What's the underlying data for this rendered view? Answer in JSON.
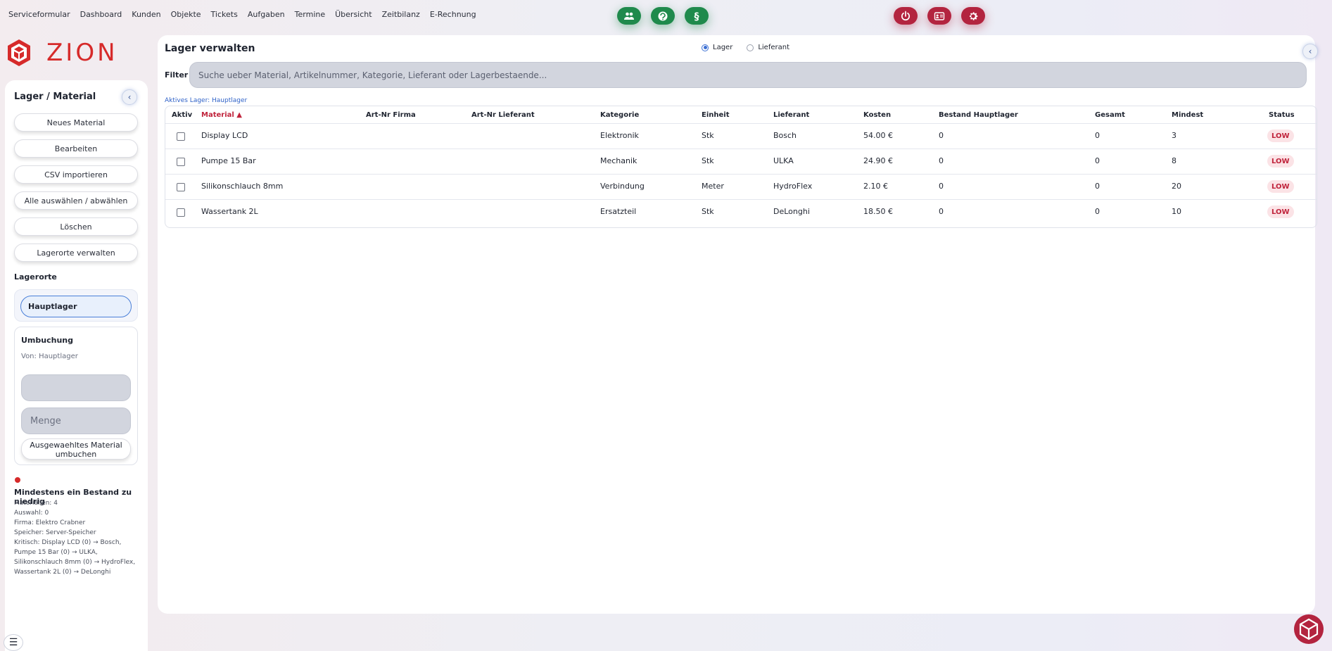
{
  "nav": [
    "Serviceformular",
    "Dashboard",
    "Kunden",
    "Objekte",
    "Tickets",
    "Aufgaben",
    "Termine",
    "Übersicht",
    "Zeitbilanz",
    "E-Rechnung"
  ],
  "top_buttons": {
    "green": [
      "users-icon",
      "support-icon",
      "paragraph-icon"
    ],
    "red": [
      "power-icon",
      "id-card-icon",
      "gear-icon"
    ],
    "green_color": "#1f8a4c",
    "red_color": "#b3243f"
  },
  "brand": {
    "name": "ZION",
    "color": "#d62a2a"
  },
  "sidebar": {
    "title": "Lager / Material",
    "buttons": [
      "Neues Material",
      "Bearbeiten",
      "CSV importieren",
      "Alle auswählen / abwählen",
      "Löschen",
      "Lagerorte verwalten"
    ],
    "lagerorte_label": "Lagerorte",
    "active_lager": "Hauptlager",
    "umbuchung": {
      "title": "Umbuchung",
      "von": "Von: Hauptlager",
      "material_value": "",
      "menge_placeholder": "Menge",
      "button_label": "Ausgewaehltes Material umbuchen"
    },
    "warning": "Mindestens ein Bestand zu niedrig",
    "info_lines": [
      "Materialien: 4",
      "Auswahl: 0",
      "Firma: Elektro Crabner",
      "Speicher: Server-Speicher",
      "Kritisch: Display LCD (0) → Bosch, Pumpe 15 Bar (0) → ULKA, Silikonschlauch 8mm (0) → HydroFlex, Wassertank 2L (0) → DeLonghi"
    ]
  },
  "main": {
    "title": "Lager verwalten",
    "radio": {
      "options": [
        "Lager",
        "Lieferant"
      ],
      "selected": "Lager"
    },
    "filter_label": "Filter",
    "filter_placeholder": "Suche ueber Material, Artikelnummer, Kategorie, Lieferant oder Lagerbestaende...",
    "active_lager_text": "Aktives Lager: Hauptlager",
    "table": {
      "headers": {
        "aktiv": "Aktiv",
        "material": "Material ▲",
        "art_firma": "Art-Nr Firma",
        "art_lieferant": "Art-Nr Lieferant",
        "kategorie": "Kategorie",
        "einheit": "Einheit",
        "lieferant": "Lieferant",
        "kosten": "Kosten",
        "bestand": "Bestand Hauptlager",
        "gesamt": "Gesamt",
        "mindest": "Mindest",
        "status": "Status"
      },
      "rows": [
        {
          "material": "Display LCD",
          "art_firma": "",
          "art_lieferant": "",
          "kategorie": "Elektronik",
          "einheit": "Stk",
          "lieferant": "Bosch",
          "kosten": "54.00 €",
          "bestand": "0",
          "gesamt": "0",
          "mindest": "3",
          "status": "LOW"
        },
        {
          "material": "Pumpe 15 Bar",
          "art_firma": "",
          "art_lieferant": "",
          "kategorie": "Mechanik",
          "einheit": "Stk",
          "lieferant": "ULKA",
          "kosten": "24.90 €",
          "bestand": "0",
          "gesamt": "0",
          "mindest": "8",
          "status": "LOW"
        },
        {
          "material": "Silikonschlauch 8mm",
          "art_firma": "",
          "art_lieferant": "",
          "kategorie": "Verbindung",
          "einheit": "Meter",
          "lieferant": "HydroFlex",
          "kosten": "2.10 €",
          "bestand": "0",
          "gesamt": "0",
          "mindest": "20",
          "status": "LOW"
        },
        {
          "material": "Wassertank 2L",
          "art_firma": "",
          "art_lieferant": "",
          "kategorie": "Ersatzteil",
          "einheit": "Stk",
          "lieferant": "DeLonghi",
          "kosten": "18.50 €",
          "bestand": "0",
          "gesamt": "0",
          "mindest": "10",
          "status": "LOW"
        }
      ]
    }
  }
}
